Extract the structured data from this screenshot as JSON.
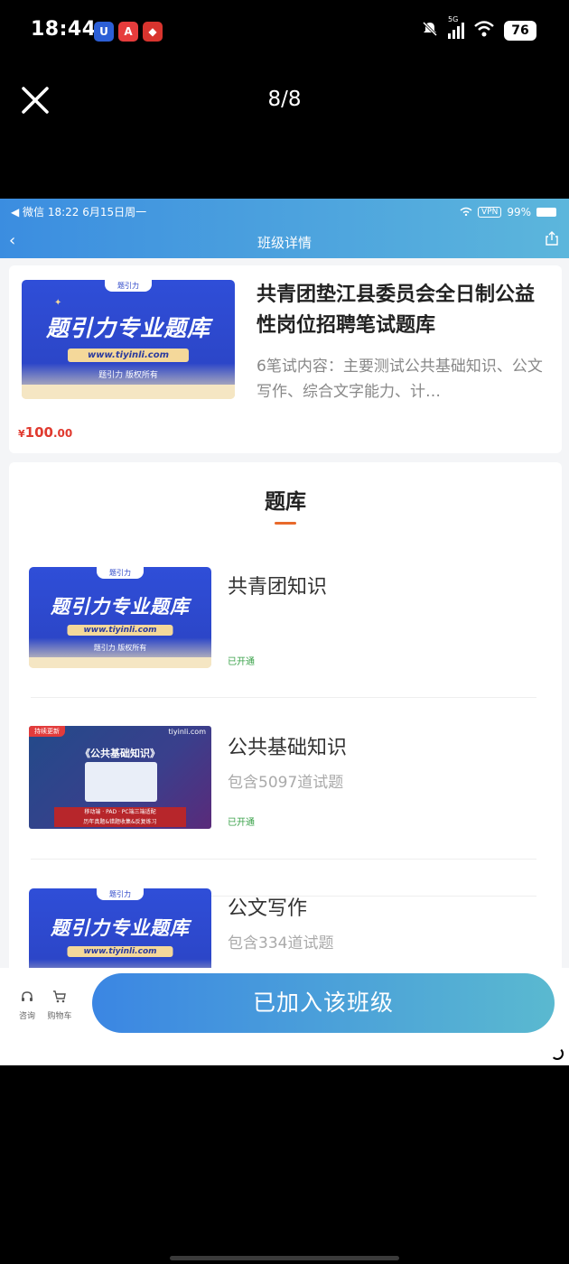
{
  "os_status": {
    "time": "18:44",
    "signal": "5G",
    "battery": "76",
    "app_icons": [
      "shield-app-icon",
      "red-a-app-icon",
      "red-app-icon"
    ]
  },
  "viewer": {
    "counter": "8/8",
    "close_icon": "close-icon"
  },
  "inner_status": {
    "left": "◀ 微信   18:22   6月15日周一",
    "vpn": "VPN",
    "battery": "99%"
  },
  "inner_nav": {
    "back": "‹",
    "title": "班级详情",
    "share_icon": "share-icon"
  },
  "course": {
    "cover": {
      "tag": "题引力",
      "big": "题引力专业题库",
      "url": "www.tiyinli.com",
      "copy": "题引力 版权所有"
    },
    "title": "共青团垫江县委员会全日制公益性岗位招聘笔试题库",
    "desc": "6笔试内容：主要测试公共基础知识、公文写作、综合文字能力、计…",
    "price_currency": "¥",
    "price_int": "100",
    "price_dec": ".00"
  },
  "bank": {
    "title": "题库",
    "items": [
      {
        "name": "共青团知识",
        "sub": "",
        "status": "已开通",
        "cover": {
          "tag": "题引力",
          "big": "题引力专业题库",
          "url": "www.tiyinli.com",
          "copy": "题引力 版权所有"
        }
      },
      {
        "name": "公共基础知识",
        "sub": "包含5097道试题",
        "status": "已开通",
        "cover": {
          "badge": "持续更新",
          "brand": "tiyinli.com",
          "heading": "《公共基础知识》",
          "red_line1": "移动端 · PAD · PC端三端适配",
          "red_line2": "历年真题&错题收集&反复练习"
        }
      },
      {
        "name": "公文写作",
        "sub": "包含334道试题",
        "status": "",
        "cover": {
          "tag": "题引力",
          "big": "题引力专业题库",
          "url": "www.tiyinli.com",
          "copy": ""
        }
      }
    ]
  },
  "bottom_bar": {
    "consult": "咨询",
    "cart": "购物车",
    "join_label": "已加入该班级"
  },
  "colors": {
    "accent_blue": "#3b86e3",
    "accent_teal": "#5ab9d0",
    "price_red": "#e03a2f",
    "status_green": "#3aa24a",
    "underline_orange": "#e8692b"
  }
}
